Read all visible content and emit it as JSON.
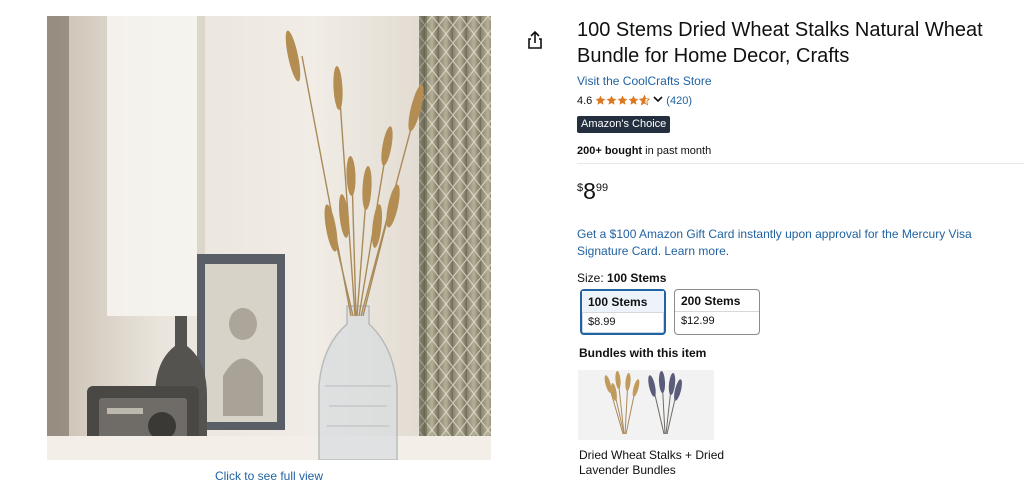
{
  "product": {
    "title": "100 Stems Dried Wheat Stalks Natural Wheat Bundle for Home Decor, Crafts",
    "store_link": "Visit the CoolCrafts Store",
    "rating_value": "4.6",
    "rating_stars": 4.6,
    "rating_count": "(420)",
    "badge": "Amazon's Choice",
    "bought_bold": "200+ bought",
    "bought_rest": " in past month"
  },
  "price": {
    "symbol": "$",
    "whole": "8",
    "fraction": "99"
  },
  "promo": "Get a $100 Amazon Gift Card instantly upon approval for the Mercury Visa Signature Card. Learn more.",
  "size": {
    "label": "Size: ",
    "selected": "100 Stems",
    "options": [
      {
        "name": "100 Stems",
        "price": "$8.99"
      },
      {
        "name": "200 Stems",
        "price": "$12.99"
      }
    ]
  },
  "bundles": {
    "heading": "Bundles with this item",
    "item_name": "Dried Wheat Stalks + Dried Lavender Bundles"
  },
  "gallery": {
    "full_view_link": "Click to see full view"
  },
  "icons": {
    "share": "share-icon",
    "star": "star-icon",
    "chevron": "chevron-down-icon"
  },
  "colors": {
    "link": "#2162a1",
    "badge_bg": "#232f3e",
    "star": "#de7921",
    "selected_border": "#2162a1"
  }
}
